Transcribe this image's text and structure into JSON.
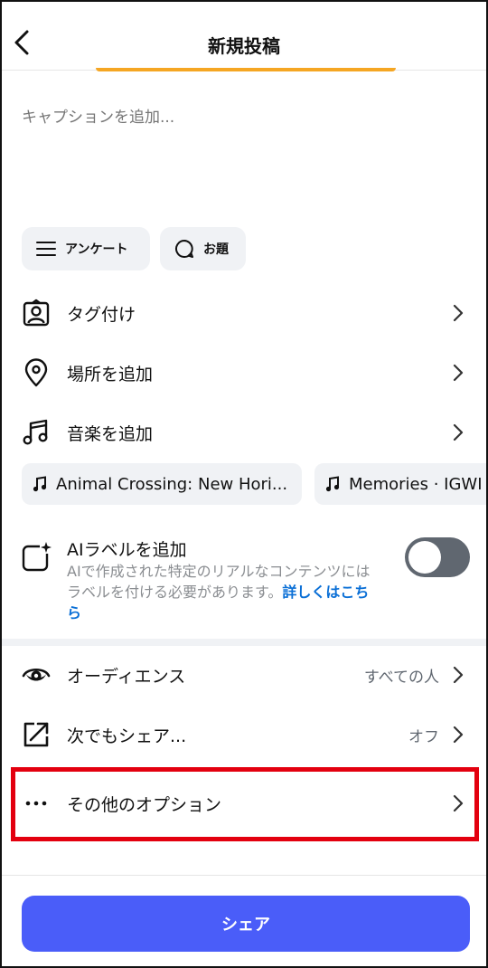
{
  "header": {
    "title": "新規投稿"
  },
  "caption": {
    "placeholder": "キャプションを追加..."
  },
  "chips": {
    "survey": "アンケート",
    "topic": "お題"
  },
  "rows": {
    "tag": "タグ付け",
    "location": "場所を追加",
    "music": "音楽を追加"
  },
  "music_suggestions": [
    {
      "label": "Animal Crossing: New Hori..."
    },
    {
      "label": "Memories · IGWI"
    }
  ],
  "ai_label": {
    "title": "AIラベルを追加",
    "description": "AIで作成された特定のリアルなコンテンツにはラベルを付ける必要があります。",
    "link": "詳しくはこちら",
    "enabled": false
  },
  "settings": {
    "audience": {
      "label": "オーディエンス",
      "value": "すべての人"
    },
    "also_share": {
      "label": "次でもシェア...",
      "value": "オフ"
    },
    "more_options": {
      "label": "その他のオプション"
    }
  },
  "share_button": "シェア",
  "colors": {
    "accent": "#4a5df9",
    "highlight": "#e3000f",
    "link": "#0a6fd6",
    "divider_orange": "#f5a623"
  }
}
